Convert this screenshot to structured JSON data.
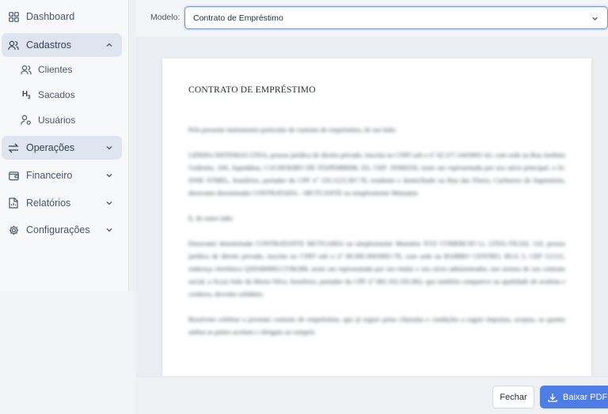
{
  "sidebar": {
    "items": [
      {
        "label": "Dashboard",
        "icon": "dashboard-icon"
      },
      {
        "label": "Cadastros",
        "icon": "users-icon",
        "expanded": true
      },
      {
        "label": "Operações",
        "icon": "transfer-icon"
      },
      {
        "label": "Financeiro",
        "icon": "wallet-icon"
      },
      {
        "label": "Relatórios",
        "icon": "report-icon"
      },
      {
        "label": "Configurações",
        "icon": "gear-icon"
      }
    ],
    "subitems": [
      {
        "label": "Clientes",
        "icon": "users-icon"
      },
      {
        "label": "Sacados",
        "icon": "h3-icon"
      },
      {
        "label": "Usuários",
        "icon": "user-settings-icon"
      }
    ]
  },
  "header": {
    "modelo_label": "Modelo:",
    "modelo_value": "Contrato de Empréstimo"
  },
  "document": {
    "title": "CONTRATO DE EMPRÉSTIMO",
    "paragraphs": [
      "Pelo presente instrumento particular de contrato de empréstimo, de um lado:",
      "LIDERA SISTEMAS LTDA, pessoa jurídica de direito privado, inscrita no CNPJ sob o nº 42.117.144/0001-42, com sede na Rua Antônio Gedeotto, 104, Aquidabas, CACHOEIRO DE ITAPEMIRIM, ES, CEP: 29300250, neste ato representada por seu sócio principal, o Sr. JOSE STMEL, brasileiro, portador do CPF nº 110.1123.367.78, residente e domiciliado na Rua das Flores, Cachoeiro de Itapemirim, doravante denominada CONTRATADA – MUTUANTE ou simplesmente Mutuante.",
      "E, de outro lado:",
      "Doravante denominada CONTRATANTE MUTUARIA ou simplesmente Mutuária XYZ COMERCIO Lt. LTDA FILIAL 110, pessoa jurídica de direito privado, inscrita no CNPJ sob o nº 08.300.300/0001-78, com sede na BAIRRO CENTRO, RUA 3, CEP 111111, endereço eletrônico QXD400002.COM.BR, neste ato representada por seu titular e seu sócio administrador, nos termos de seu contrato social, a Sr.(a) João da Morta Silva, brasileiro, portador do CPF nº 082.102.102.062, que também comparece na qualidade de avalista e credores, devedor solidário.",
      "Resolvem celebrar o presente contrato de empréstimo, que já reguei pelas cláusulas e condições a seguir impostas, aceptas, as quanto ambas as partes aceitam e obrigam ao cumprir."
    ]
  },
  "footer": {
    "close_label": "Fechar",
    "download_label": "Baixar PDF"
  },
  "colors": {
    "accent": "#4f7de6",
    "active_bg": "#dfe4ee",
    "select_border": "#6c8fe0"
  }
}
